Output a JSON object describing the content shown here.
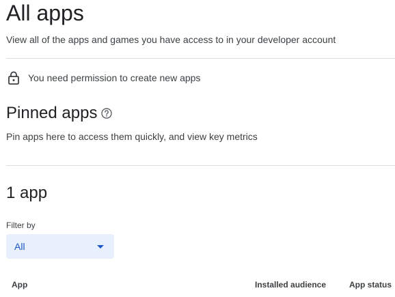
{
  "header": {
    "title": "All apps",
    "subtitle": "View all of the apps and games you have access to in your developer account"
  },
  "permission": {
    "message": "You need permission to create new apps",
    "icon": "lock-icon"
  },
  "pinned": {
    "title": "Pinned apps",
    "help_icon": "help-circle-icon",
    "description": "Pin apps here to access them quickly, and view key metrics"
  },
  "apps": {
    "count_label": "1 app",
    "filter": {
      "label": "Filter by",
      "selected": "All"
    },
    "columns": [
      "App",
      "Installed audience",
      "App status"
    ]
  },
  "colors": {
    "text_primary": "#202124",
    "text_secondary": "#3c4043",
    "divider": "#dadce0",
    "filter_bg": "#e8f0fe",
    "filter_accent": "#1a56c4"
  }
}
